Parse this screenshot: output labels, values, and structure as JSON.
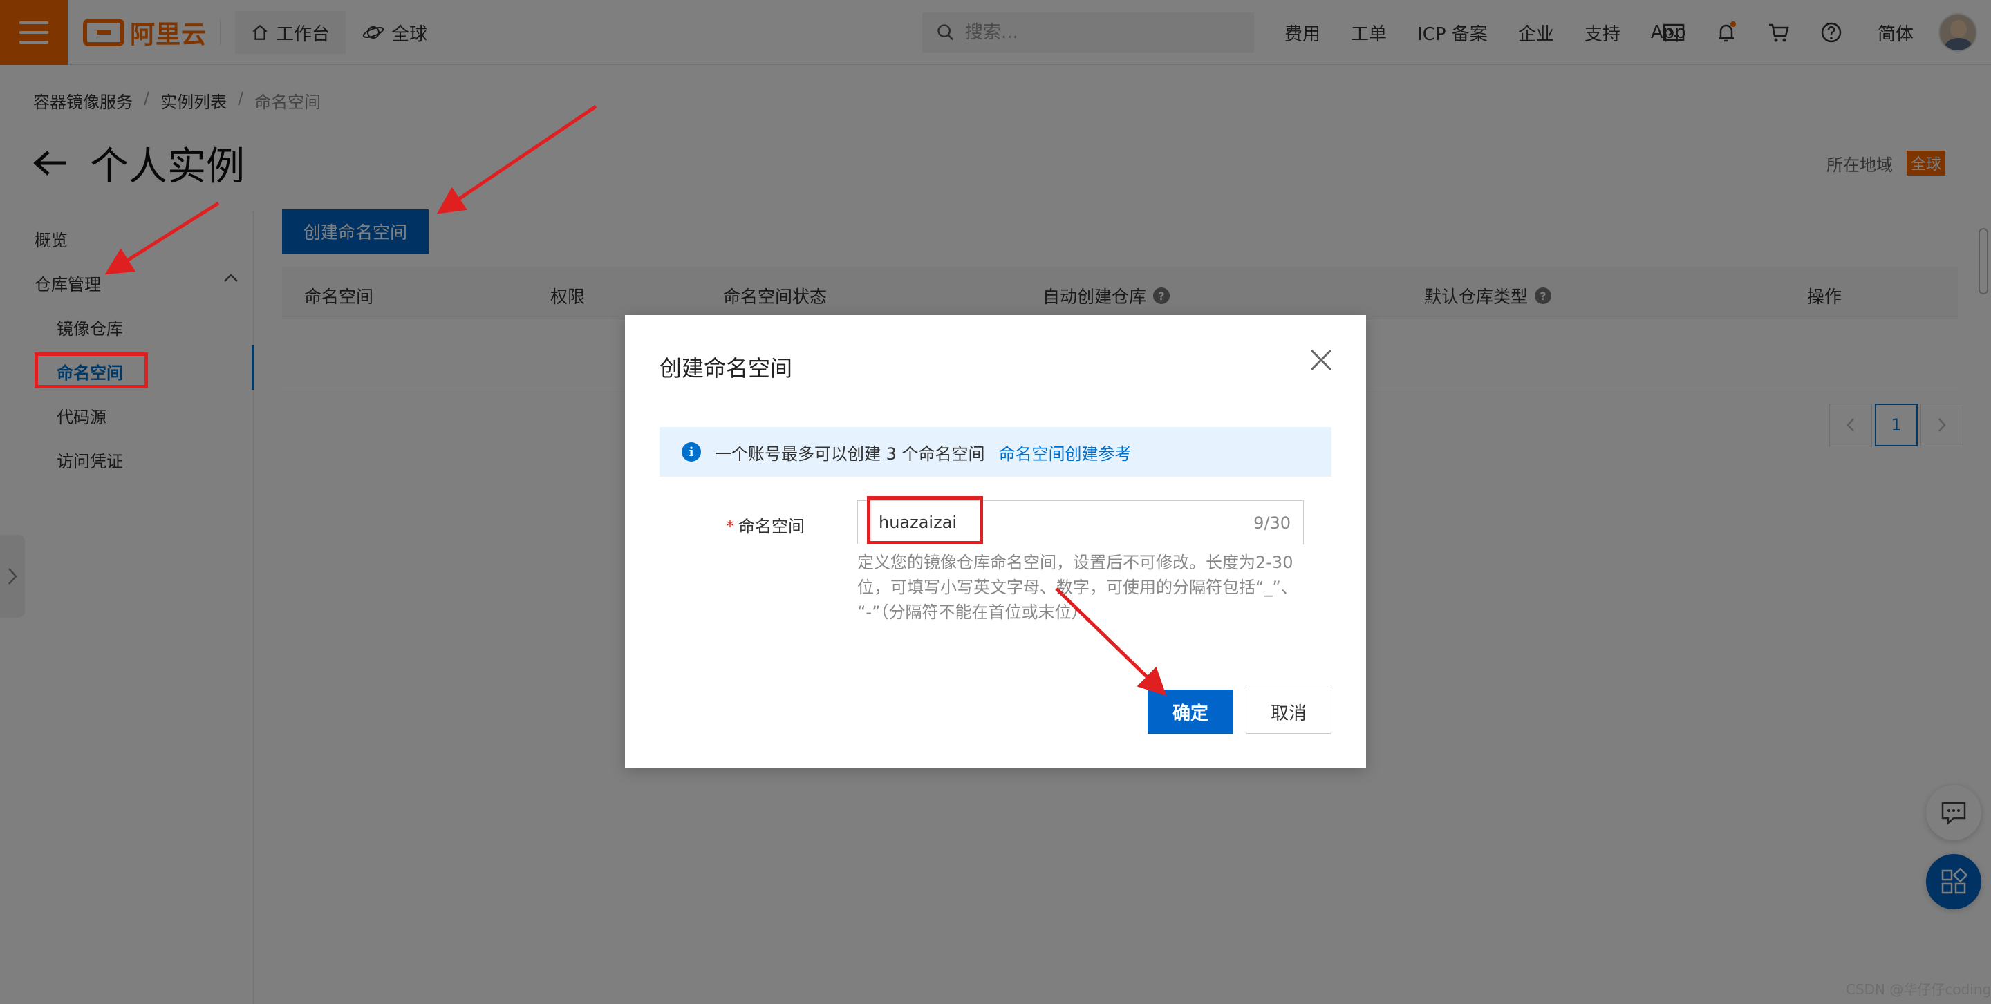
{
  "header": {
    "logo_text": "阿里云",
    "workbench_label": "工作台",
    "global_label": "全球",
    "search_placeholder": "搜索...",
    "links": [
      "费用",
      "工单",
      "ICP 备案",
      "企业",
      "支持",
      "App"
    ],
    "language": "简体",
    "icons": [
      "terminal-icon",
      "bell-icon",
      "cart-icon",
      "help-icon"
    ]
  },
  "breadcrumb": {
    "items": [
      "容器镜像服务",
      "实例列表",
      "命名空间"
    ],
    "separator": "/"
  },
  "page": {
    "title": "个人实例",
    "region_label": "所在地域",
    "region_value": "全球"
  },
  "sidebar": {
    "items": [
      {
        "label": "概览"
      },
      {
        "label": "仓库管理"
      },
      {
        "label": "镜像仓库"
      },
      {
        "label": "命名空间"
      },
      {
        "label": "代码源"
      },
      {
        "label": "访问凭证"
      }
    ]
  },
  "main": {
    "create_button": "创建命名空间",
    "columns": [
      "命名空间",
      "权限",
      "命名空间状态",
      "自动创建仓库",
      "默认仓库类型",
      "操作"
    ],
    "pagination": {
      "current_page": "1"
    }
  },
  "dialog": {
    "title": "创建命名空间",
    "alert_text": "一个账号最多可以创建 3 个命名空间",
    "alert_link": "命名空间创建参考",
    "field_required_mark": "*",
    "field_label": "命名空间",
    "field_value": "huazaizai",
    "field_counter": "9/30",
    "hint_line1": "定义您的镜像仓库命名空间，设置后不可修改。长度为2-30",
    "hint_line2": "位，可填写小写英文字母、数字，可使用的分隔符包括“_”、",
    "hint_line3": "“-”（分隔符不能在首位或末位）",
    "ok_button": "确定",
    "cancel_button": "取消"
  },
  "watermark": "CSDN @华仔仔coding",
  "colors": {
    "brand_orange": "#ff6a00",
    "primary_blue": "#0064c8",
    "annotation_red": "#e02020",
    "alert_bg": "#e6f3fe"
  }
}
